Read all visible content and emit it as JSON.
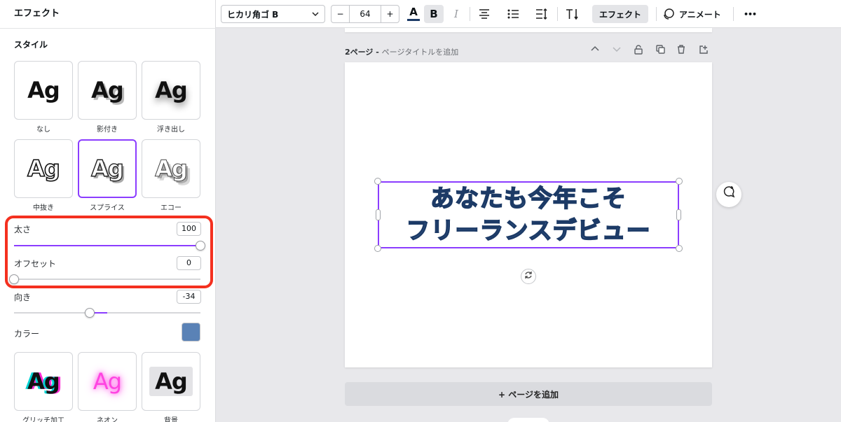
{
  "panel": {
    "title": "エフェクト",
    "style_heading": "スタイル",
    "styles": [
      {
        "sample": "Ag",
        "label": "なし"
      },
      {
        "sample": "Ag",
        "label": "影付き"
      },
      {
        "sample": "Ag",
        "label": "浮き出し"
      },
      {
        "sample": "Ag",
        "label": "中抜き"
      },
      {
        "sample": "Ag",
        "label": "スプライス",
        "selected": true
      },
      {
        "sample": "Ag",
        "label": "エコー"
      },
      {
        "sample": "Ag",
        "label": "グリッチ加工"
      },
      {
        "sample": "Ag",
        "label": "ネオン"
      },
      {
        "sample": "Ag",
        "label": "背景"
      }
    ],
    "controls": {
      "thickness": {
        "label": "太さ",
        "value": "100",
        "level_percent": 100
      },
      "offset": {
        "label": "オフセット",
        "value": "0",
        "level_percent": 0
      },
      "direction": {
        "label": "向き",
        "value": "-34",
        "level_percent": 40.5
      },
      "color": {
        "label": "カラー",
        "hex": "#5a82b6"
      }
    }
  },
  "toolbar": {
    "font": "ヒカリ角ゴ B",
    "font_size": "64",
    "minus": "−",
    "plus": "+",
    "text_color_glyph": "A",
    "bold_glyph": "B",
    "italic_glyph": "I",
    "effects_label": "エフェクト",
    "animate_label": "アニメート",
    "more_glyph": "•••"
  },
  "canvas": {
    "page_number": "2ページ - ",
    "page_title_placeholder": "ページタイトルを追加",
    "headline_line1": "あなたも今年こそ",
    "headline_line2": "フリーランスデビュー",
    "add_page_label": "+ ページを追加",
    "accent_color": "#8b3dff"
  }
}
